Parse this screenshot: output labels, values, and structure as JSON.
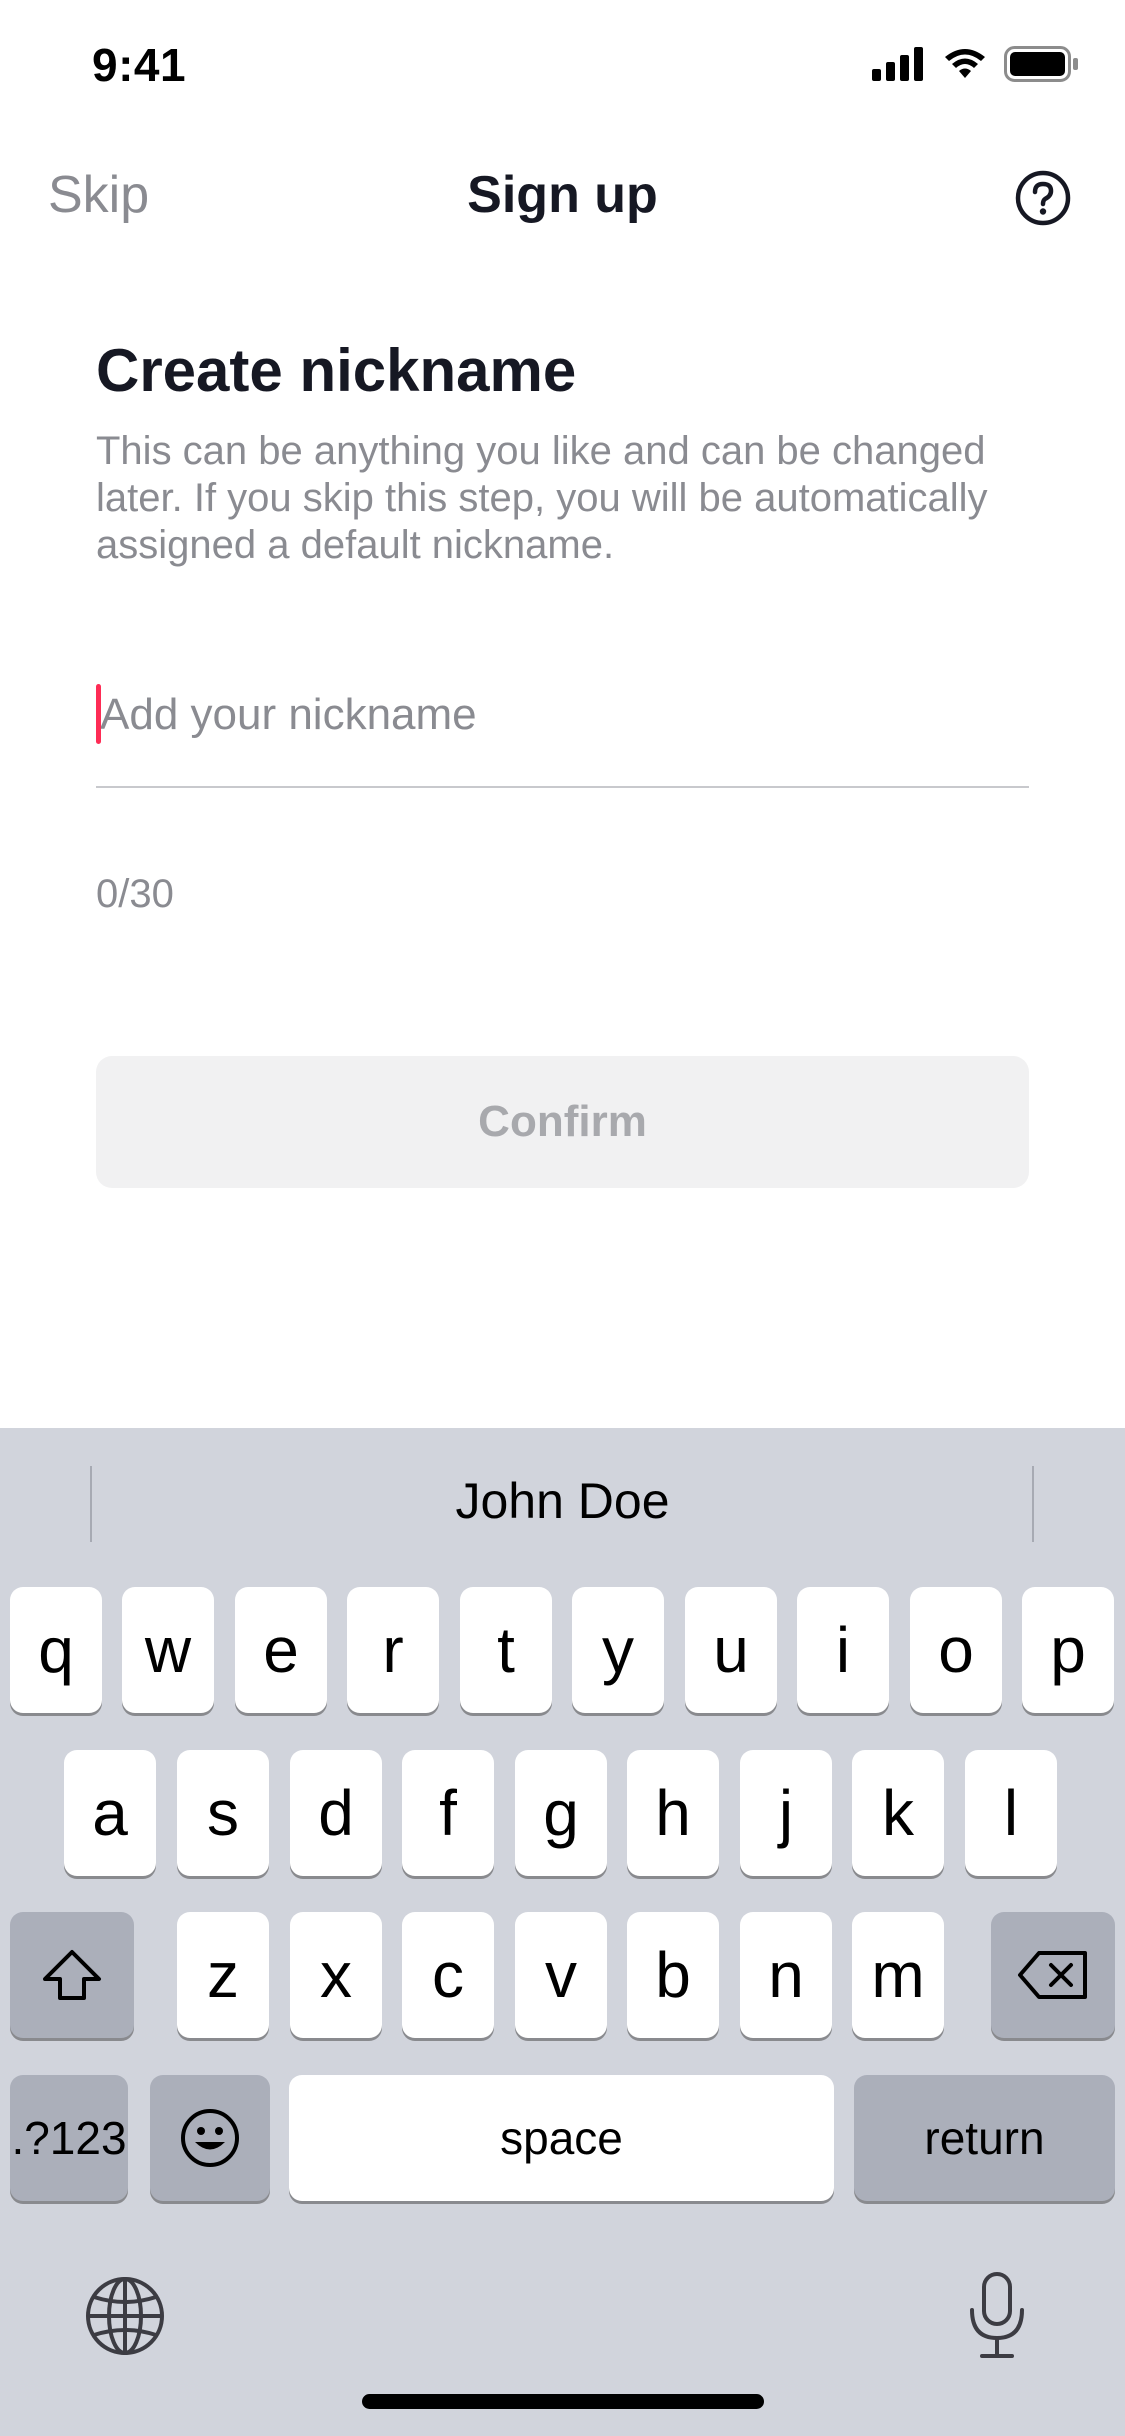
{
  "status_bar": {
    "time": "9:41",
    "icons": [
      "signal-icon",
      "wifi-icon",
      "battery-icon"
    ]
  },
  "nav": {
    "skip_label": "Skip",
    "title": "Sign up",
    "help_icon": "question-circle-icon"
  },
  "content": {
    "heading": "Create nickname",
    "description": "This can be anything you like and can be changed later. If you skip this step, you will be automatically assigned a default nickname.",
    "input_value": "",
    "input_placeholder": "Add your nickname",
    "counter": "0/30",
    "confirm_label": "Confirm"
  },
  "keyboard": {
    "suggestion": "John Doe",
    "row1": [
      "q",
      "w",
      "e",
      "r",
      "t",
      "y",
      "u",
      "i",
      "o",
      "p"
    ],
    "row2": [
      "a",
      "s",
      "d",
      "f",
      "g",
      "h",
      "j",
      "k",
      "l"
    ],
    "row3": [
      "z",
      "x",
      "c",
      "v",
      "b",
      "n",
      "m"
    ],
    "numbers_label": ".?123",
    "space_label": "space",
    "return_label": "return",
    "icons": [
      "shift-icon",
      "backspace-icon",
      "emoji-icon",
      "globe-icon",
      "microphone-icon"
    ]
  },
  "colors": {
    "accent_caret": "#fe2c55",
    "text_primary": "#161823",
    "text_secondary": "#8a8b91",
    "button_disabled_bg": "#f1f1f2",
    "keyboard_bg": "#d1d4dc"
  }
}
